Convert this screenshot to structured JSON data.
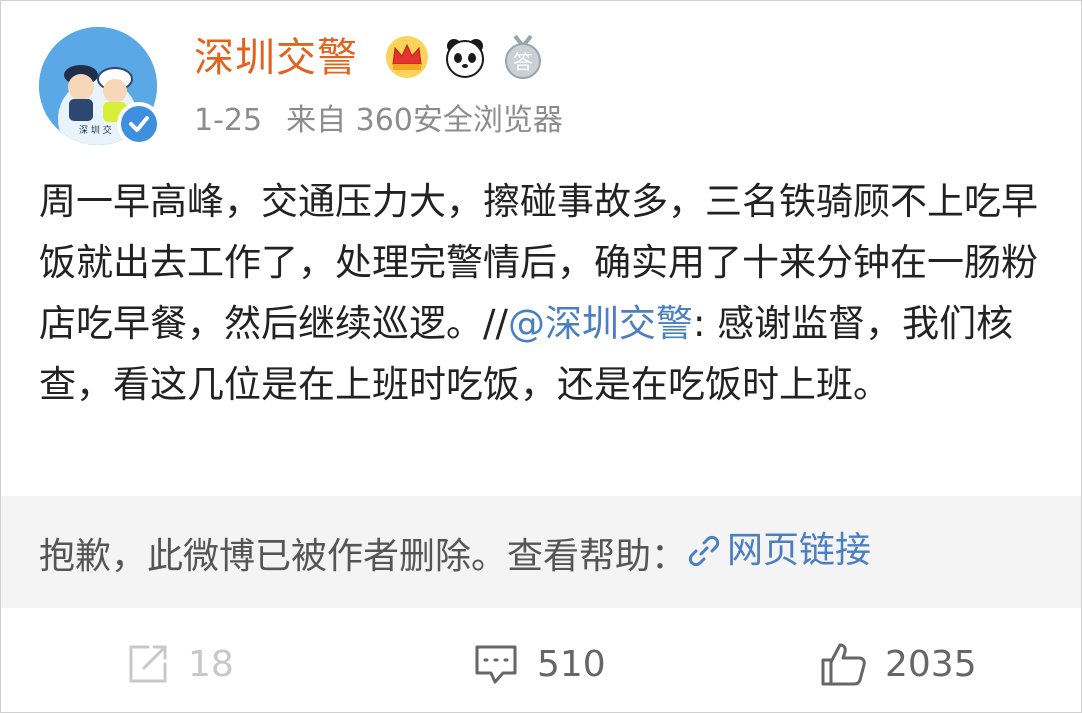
{
  "post": {
    "author_name": "深圳交警",
    "date": "1-25",
    "source": "来自 360安全浏览器",
    "avatar_text": "深 圳 交",
    "badges": [
      "crown-badge",
      "panda-badge",
      "medal-badge"
    ],
    "badge_medal_char": "答",
    "content": {
      "part1": "周一早高峰，交通压力大，擦碰事故多，三名铁骑顾不上吃早饭就出去工作了，处理完警情后，确实用了十来分钟在一肠粉店吃早餐，然后继续巡逻。//",
      "mention": "@深圳交警",
      "part2": ": 感谢监督，我们核查，看这几位是在上班时吃饭，还是在吃饭时上班。"
    }
  },
  "deleted_notice": {
    "text": "抱歉，此微博已被作者删除。查看帮助：",
    "link_label": "网页链接",
    "link_icon": "link-icon"
  },
  "actions": {
    "repost_count": "18",
    "comment_count": "510",
    "like_count": "2035"
  },
  "colors": {
    "author_name": "#e3621d",
    "link": "#4a7fc1",
    "meta": "#8c8c8c",
    "deleted_bg": "#f4f4f4",
    "verified": "#3f8fe0"
  }
}
